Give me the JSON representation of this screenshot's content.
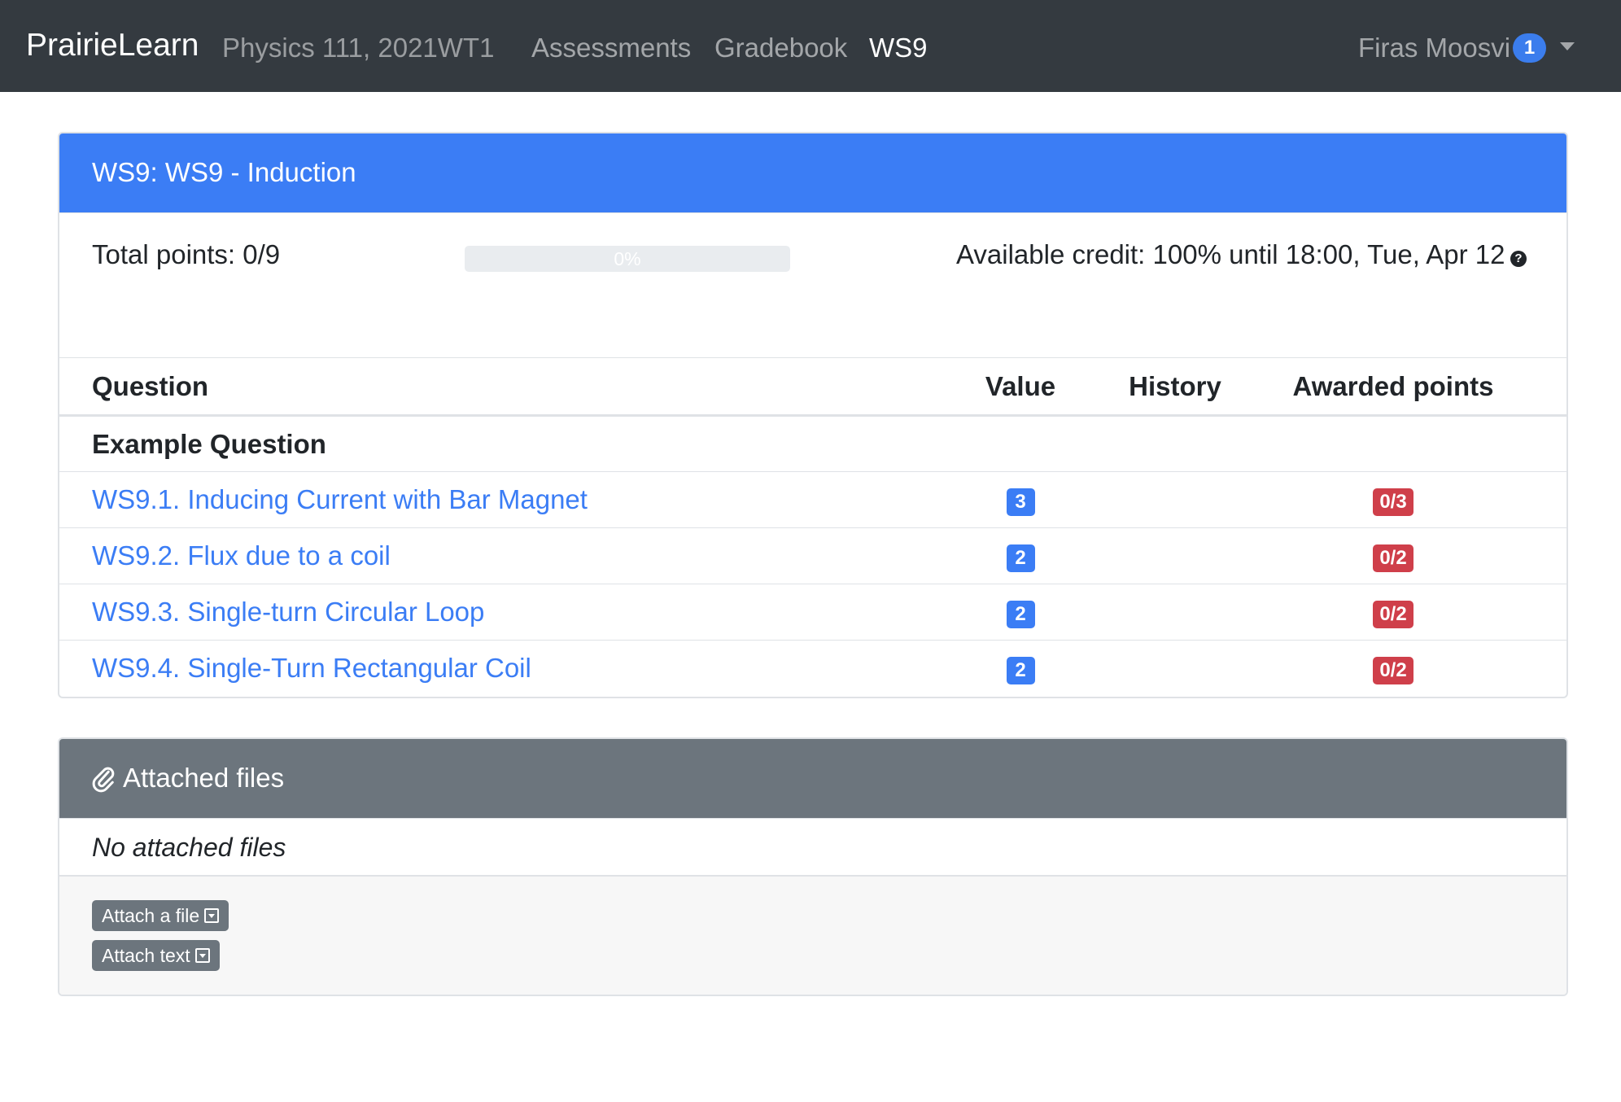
{
  "navbar": {
    "brand": "PrairieLearn",
    "course": "Physics 111, 2021WT1",
    "links": [
      {
        "label": "Assessments"
      },
      {
        "label": "Gradebook"
      },
      {
        "label": "WS9"
      }
    ],
    "user": {
      "name": "Firas Moosvi",
      "notifications": "1"
    }
  },
  "assessment": {
    "title": "WS9: WS9 - Induction",
    "total_points": "Total points: 0/9",
    "progress": {
      "percent": 0,
      "label": "0%"
    },
    "available_credit": "Available credit: 100% until 18:00, Tue, Apr 12",
    "help_icon": "question-circle-icon"
  },
  "table": {
    "headers": {
      "question": "Question",
      "value": "Value",
      "history": "History",
      "awarded": "Awarded points"
    },
    "group": "Example Question",
    "rows": [
      {
        "question": "WS9.1. Inducing Current with Bar Magnet",
        "value": "3",
        "awarded": "0/3"
      },
      {
        "question": "WS9.2. Flux due to a coil",
        "value": "2",
        "awarded": "0/2"
      },
      {
        "question": "WS9.3. Single-turn Circular Loop",
        "value": "2",
        "awarded": "0/2"
      },
      {
        "question": "WS9.4. Single-Turn Rectangular Coil",
        "value": "2",
        "awarded": "0/2"
      }
    ]
  },
  "attached": {
    "title": "Attached files",
    "icon": "paperclip-icon",
    "empty": "No attached files",
    "attach_file": "Attach a file",
    "attach_text": "Attach text"
  },
  "colors": {
    "navbar": "#343a40",
    "primary": "#3b7df5",
    "danger": "#cf3f4a",
    "secondary": "#6c757d"
  }
}
